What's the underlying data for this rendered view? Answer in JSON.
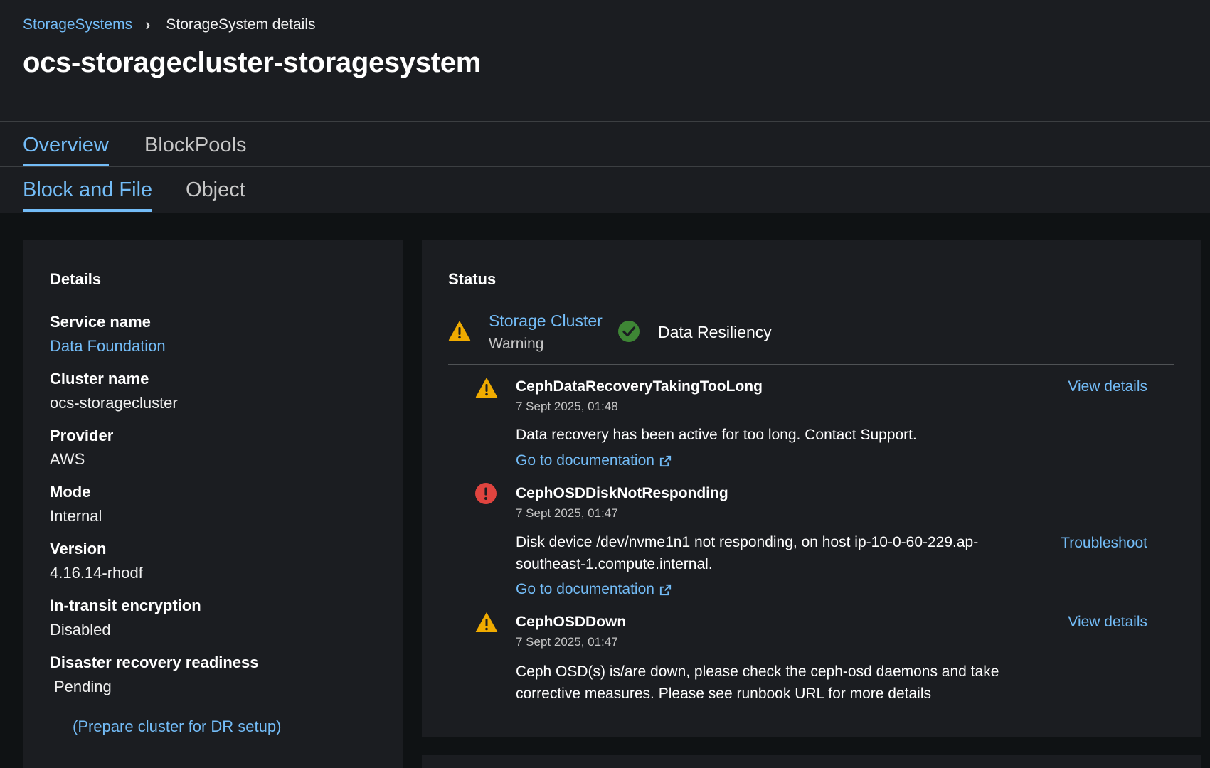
{
  "breadcrumb": {
    "parent": "StorageSystems",
    "current": "StorageSystem details"
  },
  "page_title": "ocs-storagecluster-storagesystem",
  "tabs": [
    {
      "label": "Overview",
      "active": true
    },
    {
      "label": "BlockPools",
      "active": false
    }
  ],
  "subtabs": [
    {
      "label": "Block and File",
      "active": true
    },
    {
      "label": "Object",
      "active": false
    }
  ],
  "details": {
    "title": "Details",
    "fields": [
      {
        "label": "Service name",
        "value": "Data Foundation"
      },
      {
        "label": "Cluster name",
        "value": "ocs-storagecluster"
      },
      {
        "label": "Provider",
        "value": "AWS"
      },
      {
        "label": "Mode",
        "value": "Internal"
      },
      {
        "label": "Version",
        "value": "4.16.14-rhodf"
      },
      {
        "label": "In-transit encryption",
        "value": "Disabled"
      },
      {
        "label": "Disaster recovery readiness",
        "value": "Pending"
      }
    ],
    "dr_link": "(Prepare cluster for DR setup)"
  },
  "status": {
    "title": "Status",
    "storage_cluster": {
      "label": "Storage Cluster",
      "state": "Warning"
    },
    "data_resiliency": {
      "label": "Data Resiliency"
    },
    "alerts": [
      {
        "name": "CephDataRecoveryTakingTooLong",
        "time": "7 Sept 2025, 01:48",
        "severity": "warning",
        "message": "Data recovery has been active for too long. Contact Support.",
        "doc_link": "Go to documentation",
        "action": "View details"
      },
      {
        "name": "CephOSDDiskNotResponding",
        "time": "7 Sept 2025, 01:47",
        "severity": "critical",
        "message": "Disk device /dev/nvme1n1 not responding, on host ip-10-0-60-229.ap-southeast-1.compute.internal.",
        "doc_link": "Go to documentation",
        "action": "Troubleshoot"
      },
      {
        "name": "CephOSDDown",
        "time": "7 Sept 2025, 01:47",
        "severity": "warning",
        "message": "Ceph OSD(s) is/are down, please check the ceph-osd daemons and take corrective measures. Please see runbook URL for more details",
        "action": "View details"
      }
    ]
  },
  "colors": {
    "link": "#73bcf7",
    "warning": "#f0ab00",
    "danger": "#e0443f",
    "success": "#3e8635"
  }
}
